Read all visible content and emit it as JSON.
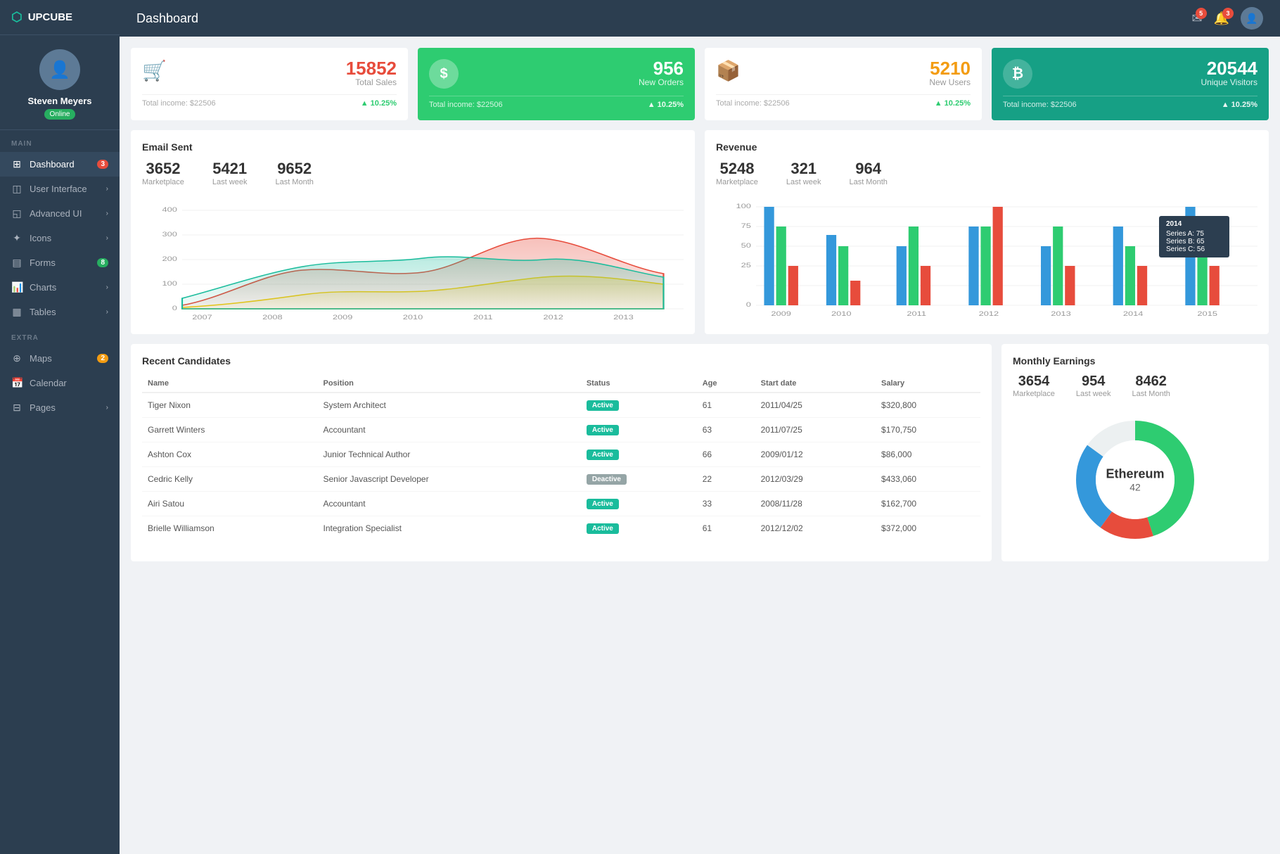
{
  "sidebar": {
    "logo": "UPCUBE",
    "user": {
      "name": "Steven Meyers",
      "status": "Online"
    },
    "sections": [
      {
        "label": "Main",
        "items": [
          {
            "id": "dashboard",
            "label": "Dashboard",
            "icon": "⊞",
            "badge": "3",
            "badgeColor": "red",
            "arrow": false,
            "active": true
          },
          {
            "id": "user-interface",
            "label": "User Interface",
            "icon": "◫",
            "badge": "",
            "arrow": true,
            "active": false
          },
          {
            "id": "advanced-ui",
            "label": "Advanced UI",
            "icon": "◱",
            "badge": "",
            "arrow": true,
            "active": false
          },
          {
            "id": "icons",
            "label": "Icons",
            "icon": "✦",
            "badge": "",
            "arrow": true,
            "active": false
          },
          {
            "id": "forms",
            "label": "Forms",
            "icon": "▤",
            "badge": "8",
            "badgeColor": "green",
            "arrow": false,
            "active": false
          },
          {
            "id": "charts",
            "label": "Charts",
            "icon": "📊",
            "badge": "",
            "arrow": true,
            "active": false
          },
          {
            "id": "tables",
            "label": "Tables",
            "icon": "▦",
            "badge": "",
            "arrow": true,
            "active": false
          }
        ]
      },
      {
        "label": "Extra",
        "items": [
          {
            "id": "maps",
            "label": "Maps",
            "icon": "⊕",
            "badge": "2",
            "badgeColor": "orange",
            "arrow": false,
            "active": false
          },
          {
            "id": "calendar",
            "label": "Calendar",
            "icon": "📅",
            "badge": "",
            "arrow": false,
            "active": false
          },
          {
            "id": "pages",
            "label": "Pages",
            "icon": "⊟",
            "badge": "",
            "arrow": true,
            "active": false
          }
        ]
      }
    ]
  },
  "header": {
    "title": "Dashboard",
    "icons": {
      "mail_badge": "5",
      "bell_badge": "3"
    }
  },
  "stat_cards": [
    {
      "id": "total-sales",
      "icon": "🛒",
      "icon_color": "red",
      "value": "15852",
      "value_color": "red",
      "label": "Total Sales",
      "footer_left": "Total income: $22506",
      "footer_right": "▲ 10.25%",
      "style": "white"
    },
    {
      "id": "new-orders",
      "icon": "$",
      "icon_color": "white",
      "value": "956",
      "value_color": "white",
      "label": "New Orders",
      "footer_left": "Total income: $22506",
      "footer_right": "▲ 10.25%",
      "style": "green"
    },
    {
      "id": "new-users",
      "icon": "📦",
      "icon_color": "orange",
      "value": "5210",
      "value_color": "orange",
      "label": "New Users",
      "footer_left": "Total income: $22506",
      "footer_right": "▲ 10.25%",
      "style": "white"
    },
    {
      "id": "unique-visitors",
      "icon": "₿",
      "icon_color": "white",
      "value": "20544",
      "value_color": "white",
      "label": "Unique Visitors",
      "footer_left": "Total income: $22506",
      "footer_right": "▲ 10.25%",
      "style": "teal"
    }
  ],
  "email_sent": {
    "title": "Email Sent",
    "stats": [
      {
        "value": "3652",
        "label": "Marketplace"
      },
      {
        "value": "5421",
        "label": "Last week"
      },
      {
        "value": "9652",
        "label": "Last Month"
      }
    ],
    "years": [
      "2007",
      "2008",
      "2009",
      "2010",
      "2011",
      "2012",
      "2013"
    ],
    "y_labels": [
      "0",
      "100",
      "200",
      "300",
      "400"
    ]
  },
  "revenue": {
    "title": "Revenue",
    "stats": [
      {
        "value": "5248",
        "label": "Marketplace"
      },
      {
        "value": "321",
        "label": "Last week"
      },
      {
        "value": "964",
        "label": "Last Month"
      }
    ],
    "years": [
      "2009",
      "2010",
      "2011",
      "2012",
      "2013",
      "2014",
      "2015"
    ],
    "y_labels": [
      "0",
      "25",
      "50",
      "75",
      "100"
    ],
    "tooltip": {
      "year": "2014",
      "series_a": "75",
      "series_b": "65",
      "series_c": "56"
    }
  },
  "candidates": {
    "title": "Recent Candidates",
    "columns": [
      "Name",
      "Position",
      "Status",
      "Age",
      "Start date",
      "Salary"
    ],
    "rows": [
      {
        "name": "Tiger Nixon",
        "position": "System Architect",
        "status": "Active",
        "age": "61",
        "start_date": "2011/04/25",
        "salary": "$320,800"
      },
      {
        "name": "Garrett Winters",
        "position": "Accountant",
        "status": "Active",
        "age": "63",
        "start_date": "2011/07/25",
        "salary": "$170,750"
      },
      {
        "name": "Ashton Cox",
        "position": "Junior Technical Author",
        "status": "Active",
        "age": "66",
        "start_date": "2009/01/12",
        "salary": "$86,000"
      },
      {
        "name": "Cedric Kelly",
        "position": "Senior Javascript Developer",
        "status": "Deactive",
        "age": "22",
        "start_date": "2012/03/29",
        "salary": "$433,060"
      },
      {
        "name": "Airi Satou",
        "position": "Accountant",
        "status": "Active",
        "age": "33",
        "start_date": "2008/11/28",
        "salary": "$162,700"
      },
      {
        "name": "Brielle Williamson",
        "position": "Integration Specialist",
        "status": "Active",
        "age": "61",
        "start_date": "2012/12/02",
        "salary": "$372,000"
      }
    ]
  },
  "monthly_earnings": {
    "title": "Monthly Earnings",
    "stats": [
      {
        "value": "3654",
        "label": "Marketplace"
      },
      {
        "value": "954",
        "label": "Last week"
      },
      {
        "value": "8462",
        "label": "Last Month"
      }
    ],
    "donut": {
      "center_label": "Ethereum",
      "center_value": "42",
      "segments": [
        {
          "color": "#2ecc71",
          "percent": 45
        },
        {
          "color": "#e74c3c",
          "percent": 15
        },
        {
          "color": "#3498db",
          "percent": 25
        },
        {
          "color": "#ecf0f1",
          "percent": 15
        }
      ]
    }
  }
}
